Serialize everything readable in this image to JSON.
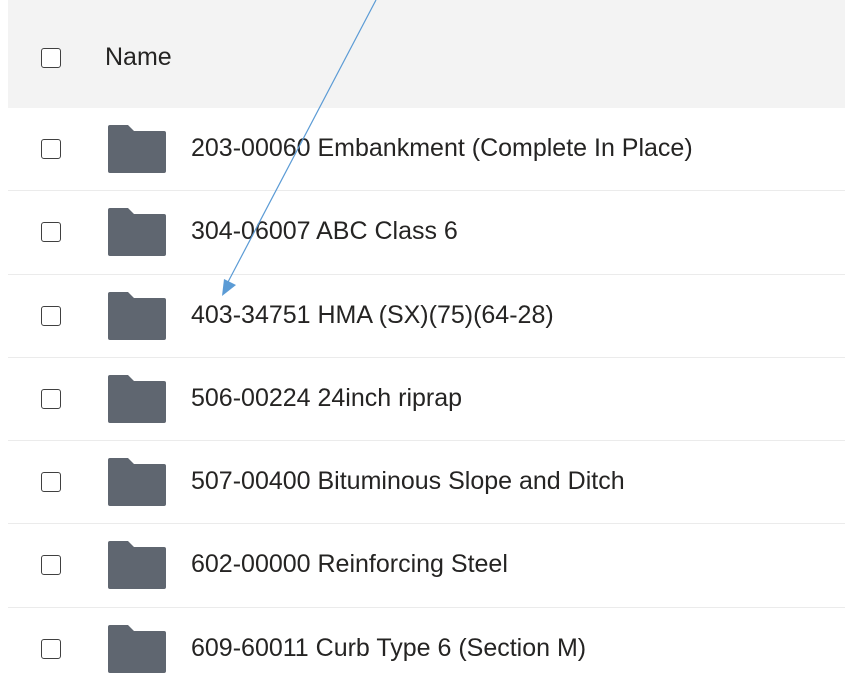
{
  "header": {
    "name_label": "Name"
  },
  "colors": {
    "header_bg": "#f3f3f3",
    "folder": "#5f6670",
    "arrow": "#5b9bd5",
    "text": "#252423"
  },
  "icons": {
    "folder": "folder-icon",
    "checkbox": "checkbox-icon",
    "annotation": "annotation-arrow"
  },
  "rows": [
    {
      "name": "203-00060 Embankment (Complete In Place)"
    },
    {
      "name": "304-06007 ABC Class 6"
    },
    {
      "name": "403-34751 HMA (SX)(75)(64-28)"
    },
    {
      "name": "506-00224 24inch riprap"
    },
    {
      "name": "507-00400 Bituminous Slope and Ditch"
    },
    {
      "name": "602-00000 Reinforcing Steel"
    },
    {
      "name": "609-60011 Curb Type 6 (Section M)"
    }
  ]
}
